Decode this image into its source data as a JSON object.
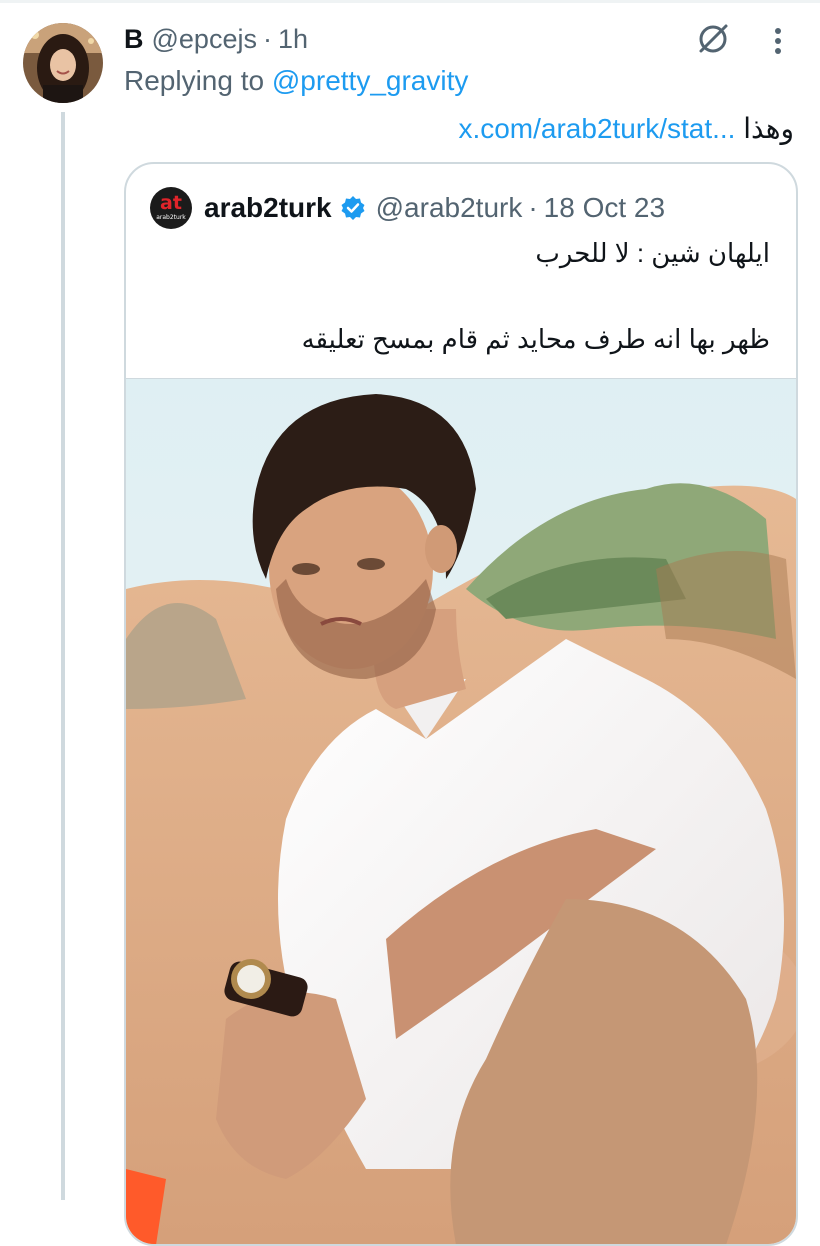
{
  "author": {
    "display_name": "B",
    "handle": "@epcejs",
    "separator": "·",
    "time": "1h"
  },
  "replying": {
    "prefix": "Replying to ",
    "mention": "@pretty_gravity"
  },
  "tweet": {
    "text_rtl": "وهذا",
    "link": "x.com/arab2turk/stat..."
  },
  "quote": {
    "logo_text": "at",
    "logo_sub": "arab2turk",
    "name": "arab2turk",
    "handle": "@arab2turk",
    "separator": "·",
    "date": "18 Oct 23",
    "line1": "ايلهان شين : لا للحرب",
    "line2": "ظهر بها انه طرف محايد ثم قام بمسح تعليقه"
  },
  "icons": {
    "grok": "grok-icon",
    "more": "more-icon",
    "verified": "verified-badge-icon"
  },
  "colors": {
    "accent": "#1d9bf0",
    "muted": "#536471",
    "border": "#cfd9de"
  }
}
